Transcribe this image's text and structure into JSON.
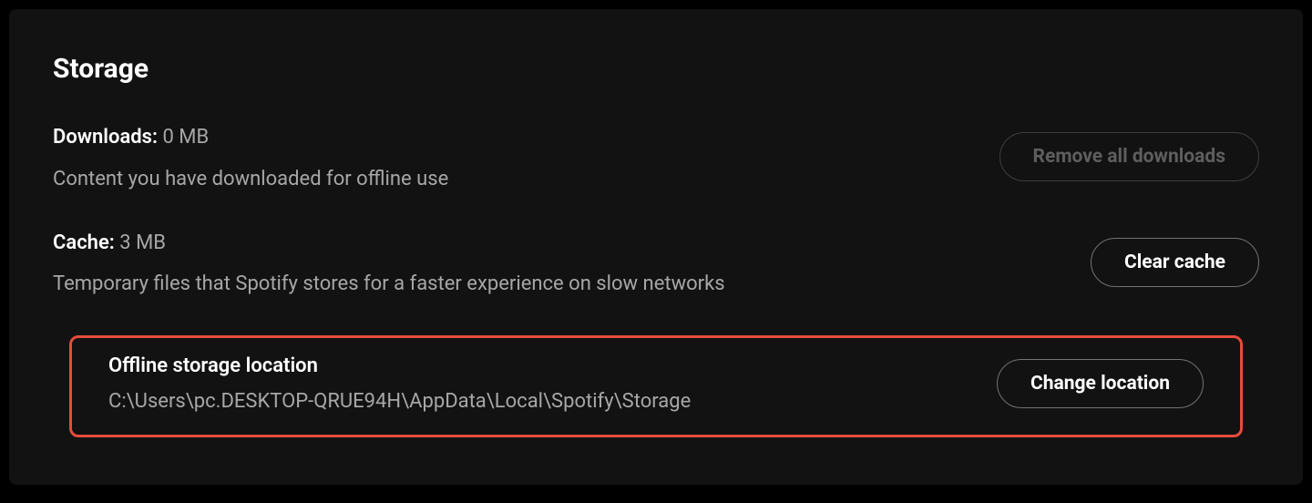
{
  "section": {
    "title": "Storage"
  },
  "downloads": {
    "label": "Downloads:",
    "value": "0 MB",
    "description": "Content you have downloaded for offline use",
    "button": "Remove all downloads"
  },
  "cache": {
    "label": "Cache:",
    "value": "3 MB",
    "description": "Temporary files that Spotify stores for a faster experience on slow networks",
    "button": "Clear cache"
  },
  "offline": {
    "title": "Offline storage location",
    "path": "C:\\Users\\pc.DESKTOP-QRUE94H\\AppData\\Local\\Spotify\\Storage",
    "button": "Change location"
  }
}
